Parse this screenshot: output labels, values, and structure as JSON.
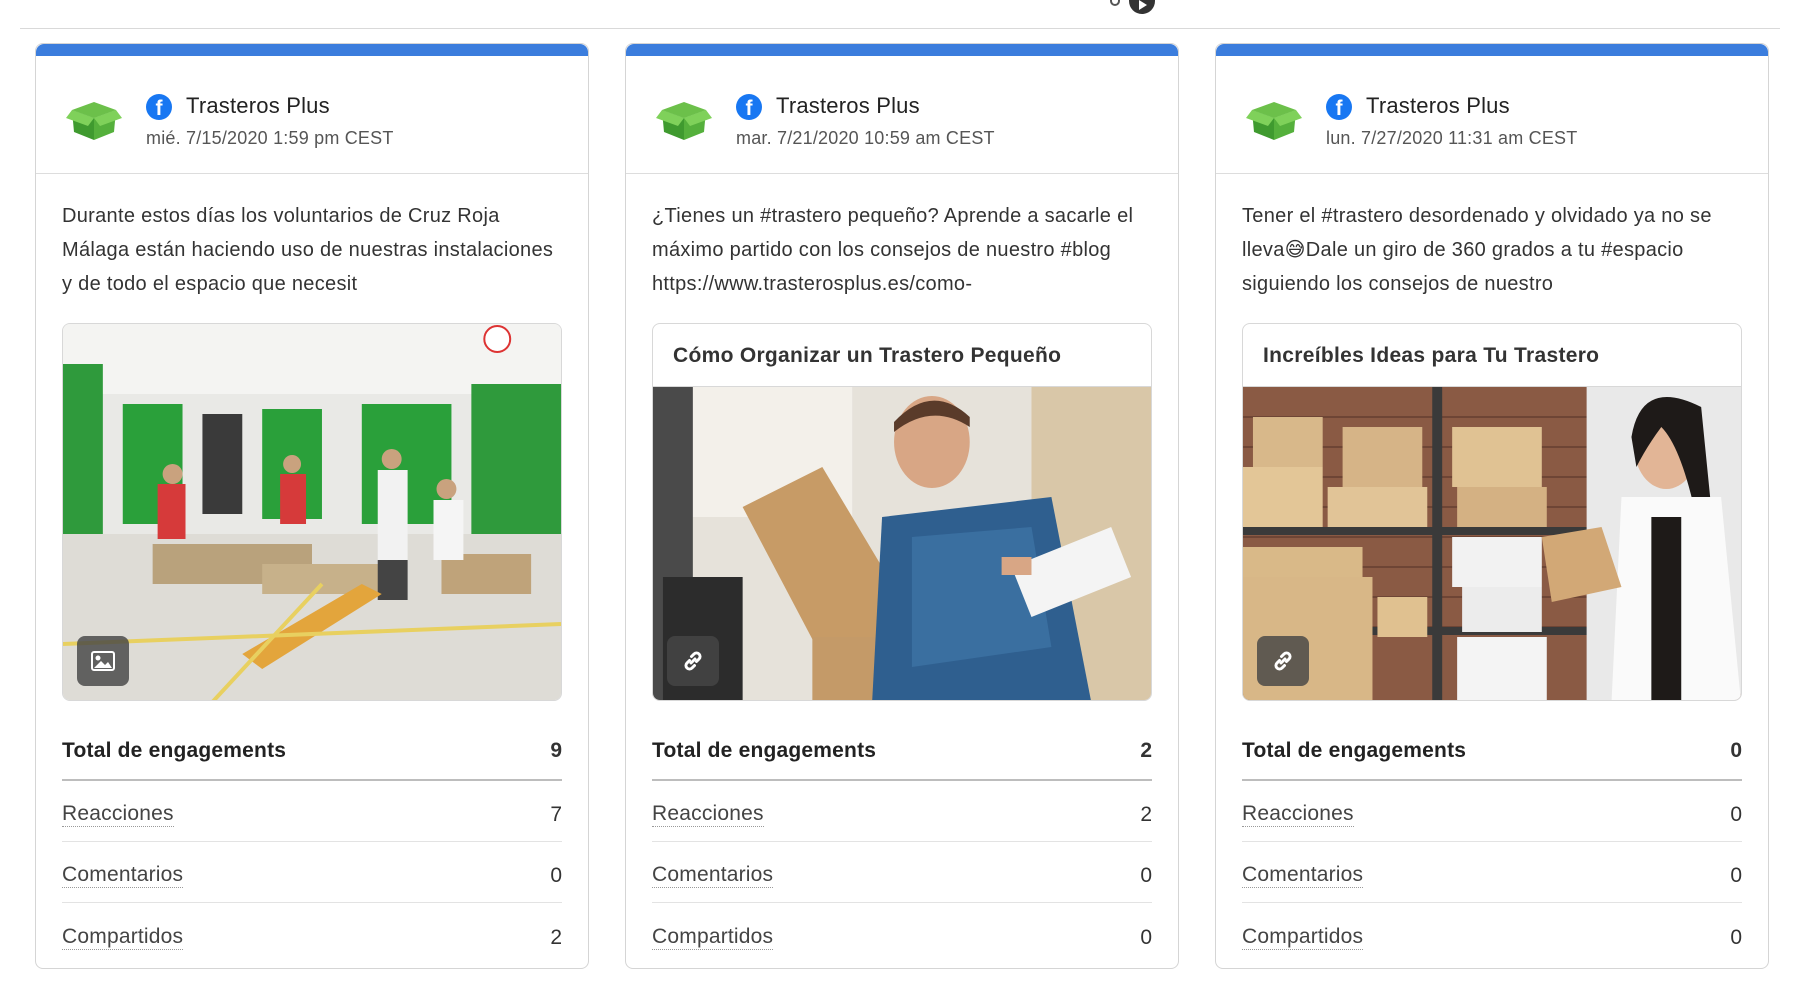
{
  "top_bar": {
    "next_icon": "play-circle-icon"
  },
  "colors": {
    "accent": "#3b7ddd",
    "facebook": "#1877f2",
    "brand_green": "#4caf50"
  },
  "cards": [
    {
      "account": "Trasteros Plus",
      "platform_icon": "facebook-icon",
      "date": "mié. 7/15/2020 1:59 pm CEST",
      "text": "Durante estos días los voluntarios de Cruz Roja Málaga están haciendo uso de nuestras instalaciones y de todo el espacio que necesit",
      "media": {
        "type": "image",
        "title": "",
        "badge_icon": "image-icon"
      },
      "stats": {
        "total_label": "Total de engagements",
        "total": "9",
        "reactions_label": "Reacciones",
        "reactions": "7",
        "comments_label": "Comentarios",
        "comments": "0",
        "shares_label": "Compartidos",
        "shares": "2"
      }
    },
    {
      "account": "Trasteros Plus",
      "platform_icon": "facebook-icon",
      "date": "mar. 7/21/2020 10:59 am CEST",
      "text": "¿Tienes un #trastero pequeño? Aprende a sacarle el máximo partido con los consejos de nuestro #blog https://www.trasterosplus.es/como-",
      "media": {
        "type": "link",
        "title": "Cómo Organizar un Trastero Pequeño",
        "badge_icon": "link-icon"
      },
      "stats": {
        "total_label": "Total de engagements",
        "total": "2",
        "reactions_label": "Reacciones",
        "reactions": "2",
        "comments_label": "Comentarios",
        "comments": "0",
        "shares_label": "Compartidos",
        "shares": "0"
      }
    },
    {
      "account": "Trasteros Plus",
      "platform_icon": "facebook-icon",
      "date": "lun. 7/27/2020 11:31 am CEST",
      "text": "Tener el #trastero desordenado y olvidado ya no se lleva😅Dale un giro de 360 grados a tu #espacio siguiendo los consejos de nuestro",
      "media": {
        "type": "link",
        "title": "Increíbles Ideas para Tu Trastero",
        "badge_icon": "link-icon"
      },
      "stats": {
        "total_label": "Total de engagements",
        "total": "0",
        "reactions_label": "Reacciones",
        "reactions": "0",
        "comments_label": "Comentarios",
        "comments": "0",
        "shares_label": "Compartidos",
        "shares": "0"
      }
    }
  ]
}
